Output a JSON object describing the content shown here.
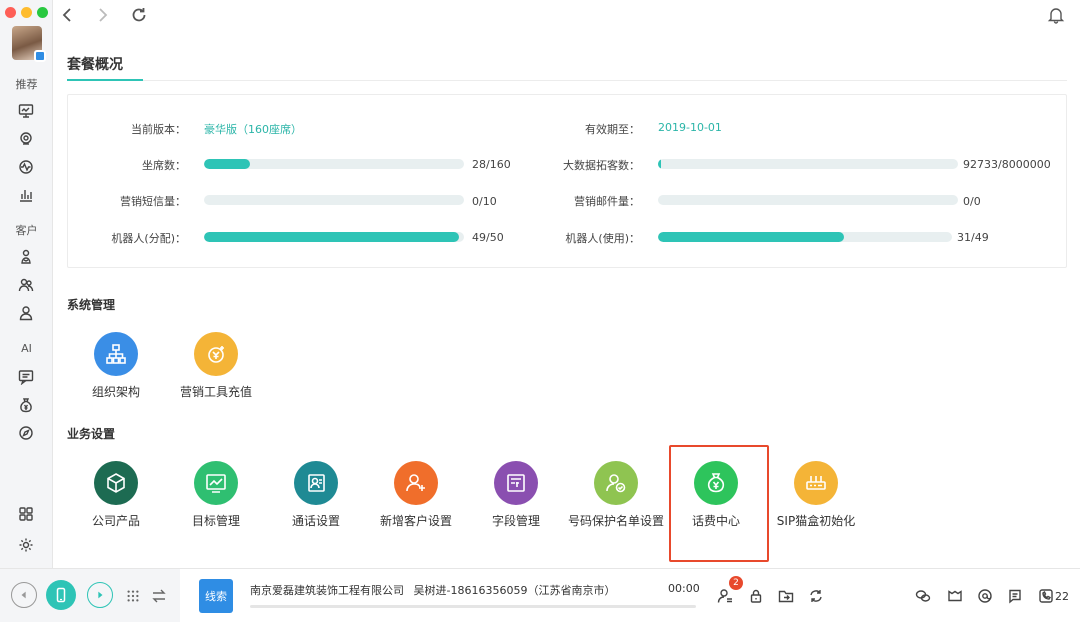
{
  "sidebar": {
    "sections": [
      {
        "label": "推荐",
        "icons": [
          "monitor-icon",
          "location-icon",
          "activity-icon",
          "bar-chart-icon"
        ]
      },
      {
        "label": "客户",
        "icons": [
          "customer-tree-icon",
          "customer-group-icon",
          "contact-icon"
        ]
      },
      {
        "label": "AI",
        "icons": [
          "message-icon",
          "money-bag-icon",
          "compass-icon"
        ]
      }
    ],
    "bottom_icons": [
      "apps-grid-icon",
      "settings-gear-icon"
    ]
  },
  "main": {
    "tab_title": "套餐概况",
    "plan": {
      "version_label": "当前版本：",
      "version_value": "豪华版（160座席）",
      "expiry_label": "有效期至：",
      "expiry_value": "2019-10-01",
      "rows": [
        {
          "label": "坐席数：",
          "text": "28/160",
          "fraction": 0.175
        },
        {
          "label": "大数据拓客数：",
          "text": "92733/8000000",
          "fraction": 0.0116
        },
        {
          "label": "营销短信量：",
          "text": "0/10",
          "fraction": 0
        },
        {
          "label": "营销邮件量：",
          "text": "0/0",
          "fraction": 0
        },
        {
          "label": "机器人(分配)：",
          "text": "49/50",
          "fraction": 0.98
        },
        {
          "label": "机器人(使用)：",
          "text": "31/49",
          "fraction": 0.633
        }
      ]
    },
    "system_section": {
      "title": "系统管理",
      "tiles": [
        {
          "label": "组织架构",
          "color": "#3a8ee6",
          "icon": "org-chart-icon"
        },
        {
          "label": "营销工具充值",
          "color": "#f4b437",
          "icon": "recharge-coin-icon"
        }
      ]
    },
    "business_section": {
      "title": "业务设置",
      "tiles": [
        {
          "label": "公司产品",
          "color": "#1d6b52",
          "icon": "product-box-icon"
        },
        {
          "label": "目标管理",
          "color": "#2fbf71",
          "icon": "target-chart-icon"
        },
        {
          "label": "通话设置",
          "color": "#1f8a94",
          "icon": "call-settings-icon"
        },
        {
          "label": "新增客户设置",
          "color": "#f06e2b",
          "icon": "add-customer-icon"
        },
        {
          "label": "字段管理",
          "color": "#8a4fb0",
          "icon": "field-manage-icon"
        },
        {
          "label": "号码保护名单设置",
          "color": "#8fc451",
          "icon": "number-protect-icon"
        },
        {
          "label": "话费中心",
          "color": "#2ec45c",
          "icon": "money-bag-icon"
        },
        {
          "label": "SIP猫盒初始化",
          "color": "#f4b437",
          "icon": "sip-box-icon"
        }
      ]
    }
  },
  "bottombar": {
    "lead_label": "线索",
    "company": "南京爱磊建筑装饰工程有限公司",
    "contact": "吴树进-18616356059（江苏省南京市）",
    "call_time": "00:00",
    "notification_count": "2",
    "phone_count": "22"
  },
  "colors": {
    "accent": "#2ec4b6",
    "highlight": "#e8492c"
  }
}
